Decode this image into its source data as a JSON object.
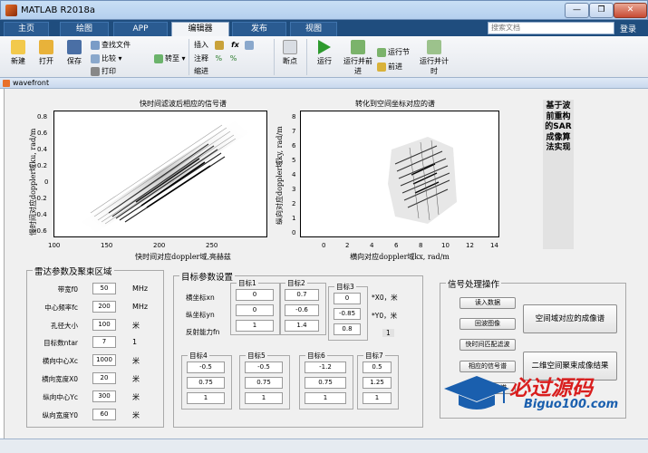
{
  "window": {
    "title": "MATLAB R2018a",
    "min_label": "—",
    "max_label": "❐",
    "close_label": "✕"
  },
  "main_tabs": [
    "主页",
    "绘图",
    "APP",
    "编辑器",
    "发布",
    "视图"
  ],
  "active_tab": "编辑器",
  "search": {
    "placeholder": "搜索文档"
  },
  "login_label": "登录",
  "toolstrip": {
    "new": "新建",
    "open": "打开",
    "save": "保存",
    "find_files": "查找文件",
    "compare": "比较",
    "print": "打印",
    "goto": "转至",
    "insert": "插入",
    "comment": "注释",
    "indent": "缩进",
    "breakpoints": "断点",
    "run": "运行",
    "run_advance": "运行并前进",
    "run_section": "运行节",
    "advance": "前进",
    "run_time": "运行并计时"
  },
  "figure_window": {
    "title": "wavefront"
  },
  "plots": {
    "left": {
      "title": "快时间滤波后相应的信号谱",
      "xlabel": "快时间对应doppler域,亮赫兹",
      "ylabel": "慢时间对应doppler域ku, rad/m",
      "xticks": [
        "100",
        "150",
        "200",
        "250"
      ],
      "yticks": [
        "0.8",
        "0.6",
        "0.4",
        "0.2",
        "0",
        "-0.2",
        "-0.4",
        "-0.6"
      ]
    },
    "right": {
      "title": "转化到空间坐标对应的谱",
      "xlabel": "横向对应doppler域kx, rad/m",
      "ylabel": "纵向对应doppler域ky, rad/m",
      "xticks": [
        "0",
        "2",
        "4",
        "6",
        "8",
        "10",
        "12",
        "14"
      ],
      "yticks": [
        "8",
        "7",
        "6",
        "5",
        "4",
        "3",
        "2",
        "1",
        "0"
      ]
    }
  },
  "side_title": "基于波前重构的SAR成像算法实现",
  "radar_panel": {
    "title": "雷达参数及聚束区域",
    "rows": [
      {
        "label": "带宽f0",
        "value": "50",
        "unit": "MHz"
      },
      {
        "label": "中心频率fc",
        "value": "200",
        "unit": "MHz"
      },
      {
        "label": "孔径大小",
        "value": "100",
        "unit": "米"
      },
      {
        "label": "目标数ntar",
        "value": "7",
        "unit": "1"
      },
      {
        "label": "横向中心Xc",
        "value": "1000",
        "unit": "米"
      },
      {
        "label": "横向宽度X0",
        "value": "20",
        "unit": "米"
      },
      {
        "label": "纵向中心Yc",
        "value": "300",
        "unit": "米"
      },
      {
        "label": "纵向宽度Y0",
        "value": "60",
        "unit": "米"
      }
    ]
  },
  "target_panel": {
    "title": "目标参数设置",
    "row_labels": [
      "横坐标xn",
      "纵坐标yn",
      "反射能力fn"
    ],
    "targets": [
      {
        "name": "目标1",
        "values": [
          "0",
          "0",
          "1"
        ]
      },
      {
        "name": "目标2",
        "values": [
          "0.7",
          "-0.6",
          "1.4"
        ]
      },
      {
        "name": "目标3",
        "values": [
          "0",
          "-0.85",
          "0.8"
        ]
      },
      {
        "name": "目标4",
        "values": [
          "-0.5",
          "0.75",
          "1"
        ]
      },
      {
        "name": "目标5",
        "values": [
          "-0.5",
          "0.75",
          "1"
        ]
      },
      {
        "name": "目标6",
        "values": [
          "-1.2",
          "0.75",
          "1"
        ]
      },
      {
        "name": "目标7",
        "values": [
          "0.5",
          "1.25",
          "1"
        ]
      }
    ],
    "notes": [
      "*X0，米",
      "*Y0，米",
      "1"
    ]
  },
  "signal_panel": {
    "title": "信号处理操作",
    "buttons": [
      "读入数据",
      "回波图像",
      "快时间匹配滤波",
      "相应的信号谱",
      "慢时间上的谱"
    ],
    "big_buttons": [
      "空间域对应的成像谱",
      "二维空间聚束成像结果"
    ]
  },
  "watermark": {
    "main": "必过源码",
    "sub": "Biguo100.com"
  },
  "colors": {
    "tab_bar": "#1f4d7e",
    "accent": "#d91e1e",
    "brand_blue": "#1a5fae"
  }
}
